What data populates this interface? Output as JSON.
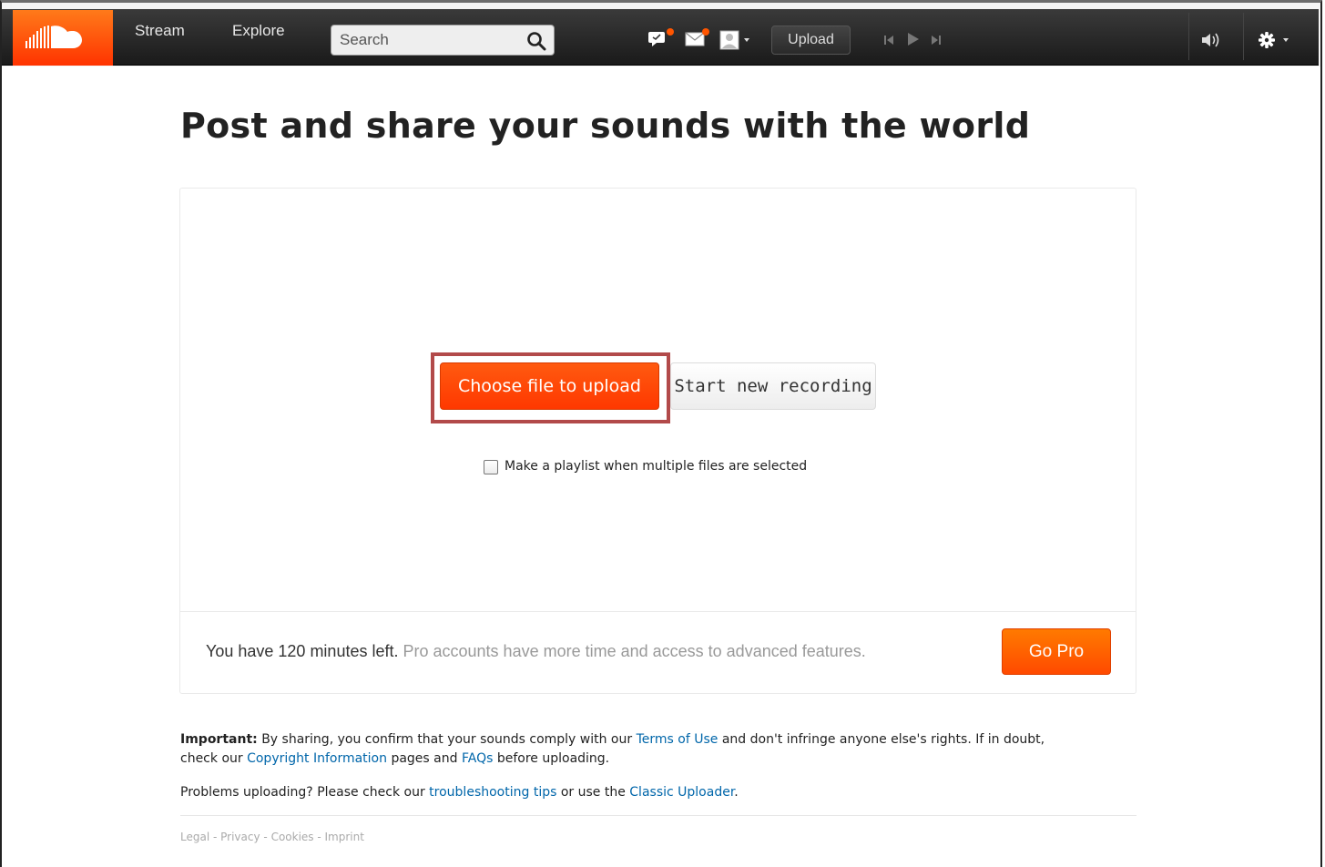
{
  "nav": {
    "stream": "Stream",
    "explore": "Explore",
    "search_placeholder": "Search",
    "upload": "Upload"
  },
  "page": {
    "title": "Post and share your sounds with the world"
  },
  "upload": {
    "choose_file": "Choose file to upload",
    "start_recording": "Start new recording",
    "playlist_label": "Make a playlist when multiple files are selected",
    "playlist_checked": false
  },
  "quota": {
    "minutes_left": "You have 120 minutes left.",
    "pro_pitch": "Pro accounts have more time and access to advanced features.",
    "go_pro": "Go Pro"
  },
  "info": {
    "important_label": "Important:",
    "important_text_1": "By sharing, you confirm that your sounds comply with our",
    "terms_link": "Terms of Use",
    "important_text_2": "and don't infringe anyone else's rights. If in doubt,",
    "important_text_3": "check our",
    "copyright_link": "Copyright Information",
    "important_text_4": "pages and",
    "faqs_link": "FAQs",
    "important_text_5": "before uploading.",
    "problems_text_1": "Problems uploading? Please check our",
    "troubleshooting_link": "troubleshooting tips",
    "problems_text_2": "or use the",
    "classic_link": "Classic Uploader",
    "problems_text_3": "."
  },
  "footer": {
    "links": [
      "Legal",
      "Privacy",
      "Cookies",
      "Imprint"
    ],
    "separator": " - "
  },
  "colors": {
    "brand": "#ff5500",
    "link": "#0066aa",
    "highlight_outline": "#b24a4a"
  },
  "icons": {
    "logo": "soundcloud-logo",
    "search": "search-icon",
    "messages": "speech-bubble-icon",
    "mail": "envelope-icon",
    "avatar": "user-avatar-icon",
    "previous": "skip-previous-icon",
    "play": "play-icon",
    "next": "skip-next-icon",
    "volume": "volume-icon",
    "settings": "gear-icon"
  }
}
